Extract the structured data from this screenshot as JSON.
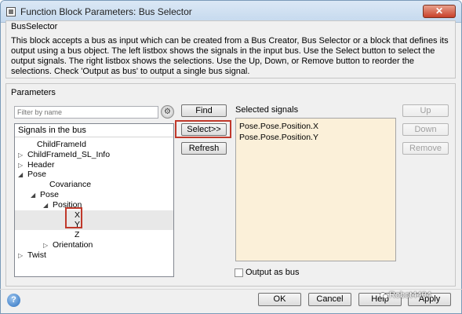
{
  "window": {
    "title": "Function Block Parameters: Bus Selector",
    "close_glyph": "✕"
  },
  "block": {
    "name": "BusSelector",
    "description": "This block accepts a bus as input which can be created from a Bus Creator, Bus Selector or a block that defines its output using a bus object. The left listbox shows the signals in the input bus. Use the Select button to select the output signals. The right listbox shows the selections. Use the Up, Down, or Remove button to reorder the selections. Check 'Output as bus' to output a single bus signal."
  },
  "parameters": {
    "label": "Parameters",
    "filter": {
      "placeholder": "Filter by name",
      "options_icon": "filter-options-icon"
    },
    "tree": {
      "header": "Signals in the bus",
      "items": [
        {
          "label": "ChildFrameId",
          "arrow": ""
        },
        {
          "label": "ChildFrameId_SL_Info",
          "arrow": "▷"
        },
        {
          "label": "Header",
          "arrow": "▷"
        },
        {
          "label": "Pose",
          "arrow": "◢"
        },
        {
          "label": "Covariance",
          "arrow": ""
        },
        {
          "label": "Pose",
          "arrow": "◢"
        },
        {
          "label": "Position",
          "arrow": "◢"
        },
        {
          "label": "X",
          "arrow": ""
        },
        {
          "label": "Y",
          "arrow": ""
        },
        {
          "label": "Z",
          "arrow": ""
        },
        {
          "label": "Orientation",
          "arrow": "▷"
        },
        {
          "label": "Twist",
          "arrow": "▷"
        }
      ]
    },
    "buttons": {
      "find": "Find",
      "select": "Select>>",
      "refresh": "Refresh"
    },
    "selected": {
      "title": "Selected signals",
      "items": [
        "Pose.Pose.Position.X",
        "Pose.Pose.Position.Y"
      ]
    },
    "reorder": {
      "up": "Up",
      "down": "Down",
      "remove": "Remove"
    },
    "output_as_bus": {
      "label": "Output as bus",
      "checked": false
    }
  },
  "footer": {
    "help_glyph": "?",
    "ok": "OK",
    "cancel": "Cancel",
    "help": "Help",
    "apply": "Apply"
  },
  "watermark": "Robot4404",
  "colors": {
    "selected_bg": "#fbf0d9",
    "highlight_red": "#c0392b"
  }
}
